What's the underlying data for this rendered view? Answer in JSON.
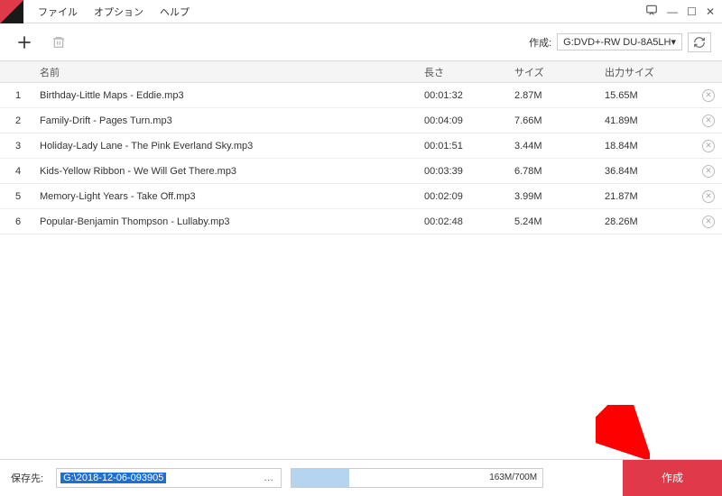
{
  "menu": {
    "file": "ファイル",
    "option": "オプション",
    "help": "ヘルプ"
  },
  "toolbar": {
    "device_label": "作成:",
    "device_value": "G:DVD+-RW DU-8A5LH"
  },
  "headers": {
    "name": "名前",
    "length": "長さ",
    "size": "サイズ",
    "out_size": "出力サイズ"
  },
  "rows": [
    {
      "n": "1",
      "name": "Birthday-Little Maps - Eddie.mp3",
      "len": "00:01:32",
      "size": "2.87M",
      "out": "15.65M"
    },
    {
      "n": "2",
      "name": "Family-Drift - Pages Turn.mp3",
      "len": "00:04:09",
      "size": "7.66M",
      "out": "41.89M"
    },
    {
      "n": "3",
      "name": "Holiday-Lady Lane - The Pink Everland Sky.mp3",
      "len": "00:01:51",
      "size": "3.44M",
      "out": "18.84M"
    },
    {
      "n": "4",
      "name": "Kids-Yellow Ribbon - We Will Get There.mp3",
      "len": "00:03:39",
      "size": "6.78M",
      "out": "36.84M"
    },
    {
      "n": "5",
      "name": "Memory-Light Years - Take Off.mp3",
      "len": "00:02:09",
      "size": "3.99M",
      "out": "21.87M"
    },
    {
      "n": "6",
      "name": "Popular-Benjamin Thompson - Lullaby.mp3",
      "len": "00:02:48",
      "size": "5.24M",
      "out": "28.26M"
    }
  ],
  "footer": {
    "save_label": "保存先:",
    "path": "G:\\2018-12-06-093905",
    "progress_text": "163M/700M",
    "create_label": "作成"
  }
}
